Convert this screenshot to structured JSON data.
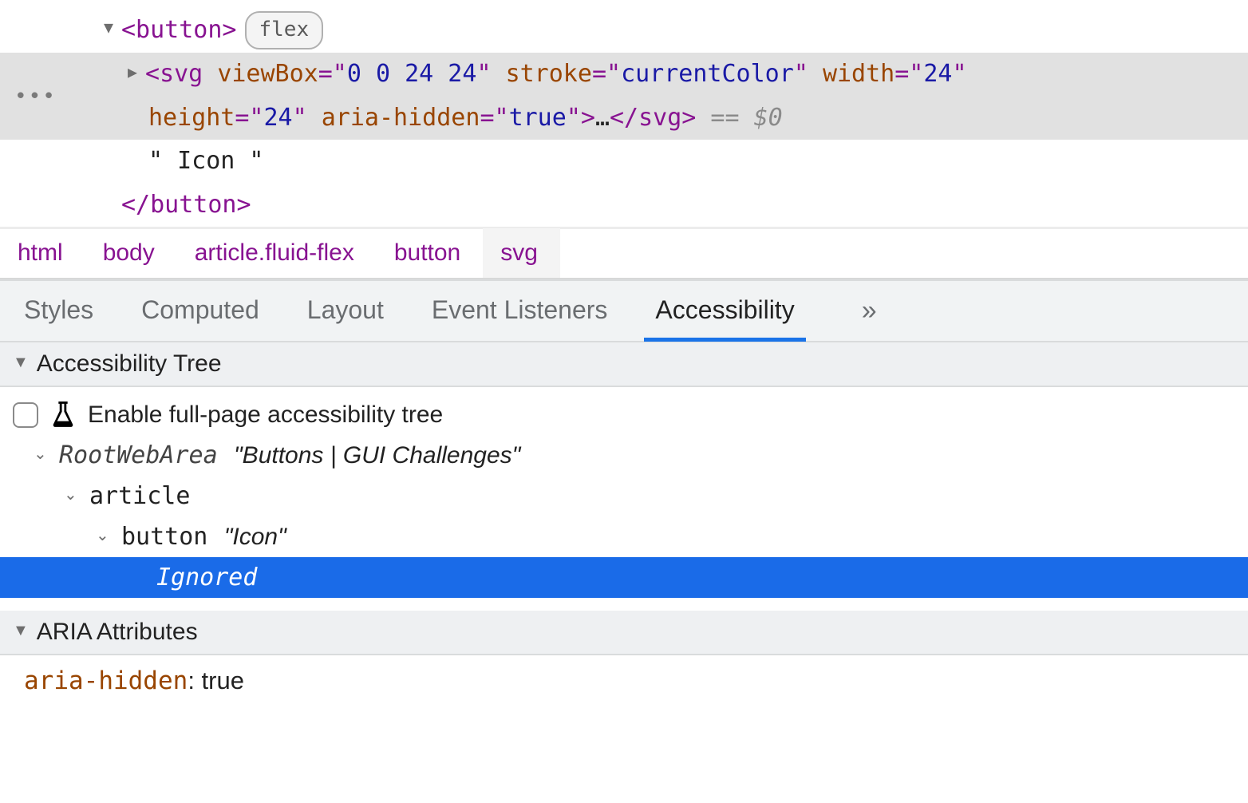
{
  "dom": {
    "button_open": "<button>",
    "button_close": "</button>",
    "flex_badge": "flex",
    "svg": {
      "open_tag": "svg",
      "attrs": [
        {
          "name": "viewBox",
          "value": "0 0 24 24"
        },
        {
          "name": "stroke",
          "value": "currentColor"
        },
        {
          "name": "width",
          "value": "24"
        },
        {
          "name": "height",
          "value": "24"
        },
        {
          "name": "aria-hidden",
          "value": "true"
        }
      ],
      "ellipsis": "…",
      "close_tag": "</svg>",
      "eq_zero": " == $0"
    },
    "text_node": "\" Icon \""
  },
  "breadcrumb": [
    "html",
    "body",
    "article.fluid-flex",
    "button",
    "svg"
  ],
  "tabs": {
    "items": [
      "Styles",
      "Computed",
      "Layout",
      "Event Listeners",
      "Accessibility"
    ],
    "active_index": 4,
    "overflow_glyph": "»"
  },
  "a11y": {
    "section_title": "Accessibility Tree",
    "enable_label": "Enable full-page accessibility tree",
    "tree": {
      "root_role": "RootWebArea",
      "root_name": "\"Buttons | GUI Challenges\"",
      "article_role": "article",
      "button_role": "button",
      "button_name": "\"Icon\"",
      "ignored_label": "Ignored"
    }
  },
  "aria_section": {
    "title": "ARIA Attributes",
    "key": "aria-hidden",
    "value": "true"
  }
}
